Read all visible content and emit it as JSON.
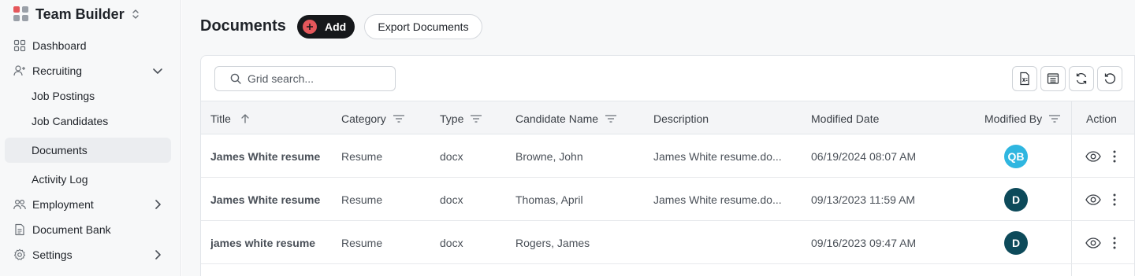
{
  "brand": {
    "name": "Team Builder",
    "logo_colors": [
      "#e5575b",
      "#9aa0a8",
      "#9aa0a8",
      "#9aa0a8"
    ]
  },
  "sidebar": {
    "items": [
      {
        "label": "Dashboard",
        "icon": "dashboard-icon"
      },
      {
        "label": "Recruiting",
        "icon": "user-plus-icon",
        "expanded": true
      },
      {
        "label": "Employment",
        "icon": "users-icon",
        "expanded": false
      },
      {
        "label": "Document Bank",
        "icon": "document-icon"
      },
      {
        "label": "Settings",
        "icon": "gear-icon",
        "expanded": false
      }
    ],
    "recruiting_children": [
      {
        "label": "Job Postings"
      },
      {
        "label": "Job Candidates"
      },
      {
        "label": "Documents",
        "active": true
      },
      {
        "label": "Activity Log"
      }
    ]
  },
  "page": {
    "title": "Documents",
    "add_label": "Add",
    "export_label": "Export Documents"
  },
  "grid": {
    "search_placeholder": "Grid search...",
    "toolbar_icons": [
      "export-excel-icon",
      "column-chooser-icon",
      "refresh-icon",
      "reset-icon"
    ],
    "columns": {
      "title": "Title",
      "category": "Category",
      "type": "Type",
      "candidate": "Candidate Name",
      "description": "Description",
      "modified_date": "Modified Date",
      "modified_by": "Modified By",
      "action": "Action"
    },
    "sort": {
      "column": "Title",
      "direction": "ascending"
    },
    "rows": [
      {
        "title": "James White resume",
        "category": "Resume",
        "type": "docx",
        "candidate": "Browne, John",
        "description": "James White resume.do...",
        "modified_date": "06/19/2024 08:07 AM",
        "modified_by": "QB",
        "avatar_color": "#2fb6e0"
      },
      {
        "title": "James White resume",
        "category": "Resume",
        "type": "docx",
        "candidate": "Thomas, April",
        "description": "James White resume.do...",
        "modified_date": "09/13/2023 11:59 AM",
        "modified_by": "D",
        "avatar_color": "#0d4a5a"
      },
      {
        "title": "james white resume",
        "category": "Resume",
        "type": "docx",
        "candidate": "Rogers, James",
        "description": "",
        "modified_date": "09/16/2023 09:47 AM",
        "modified_by": "D",
        "avatar_color": "#0d4a5a"
      }
    ]
  }
}
